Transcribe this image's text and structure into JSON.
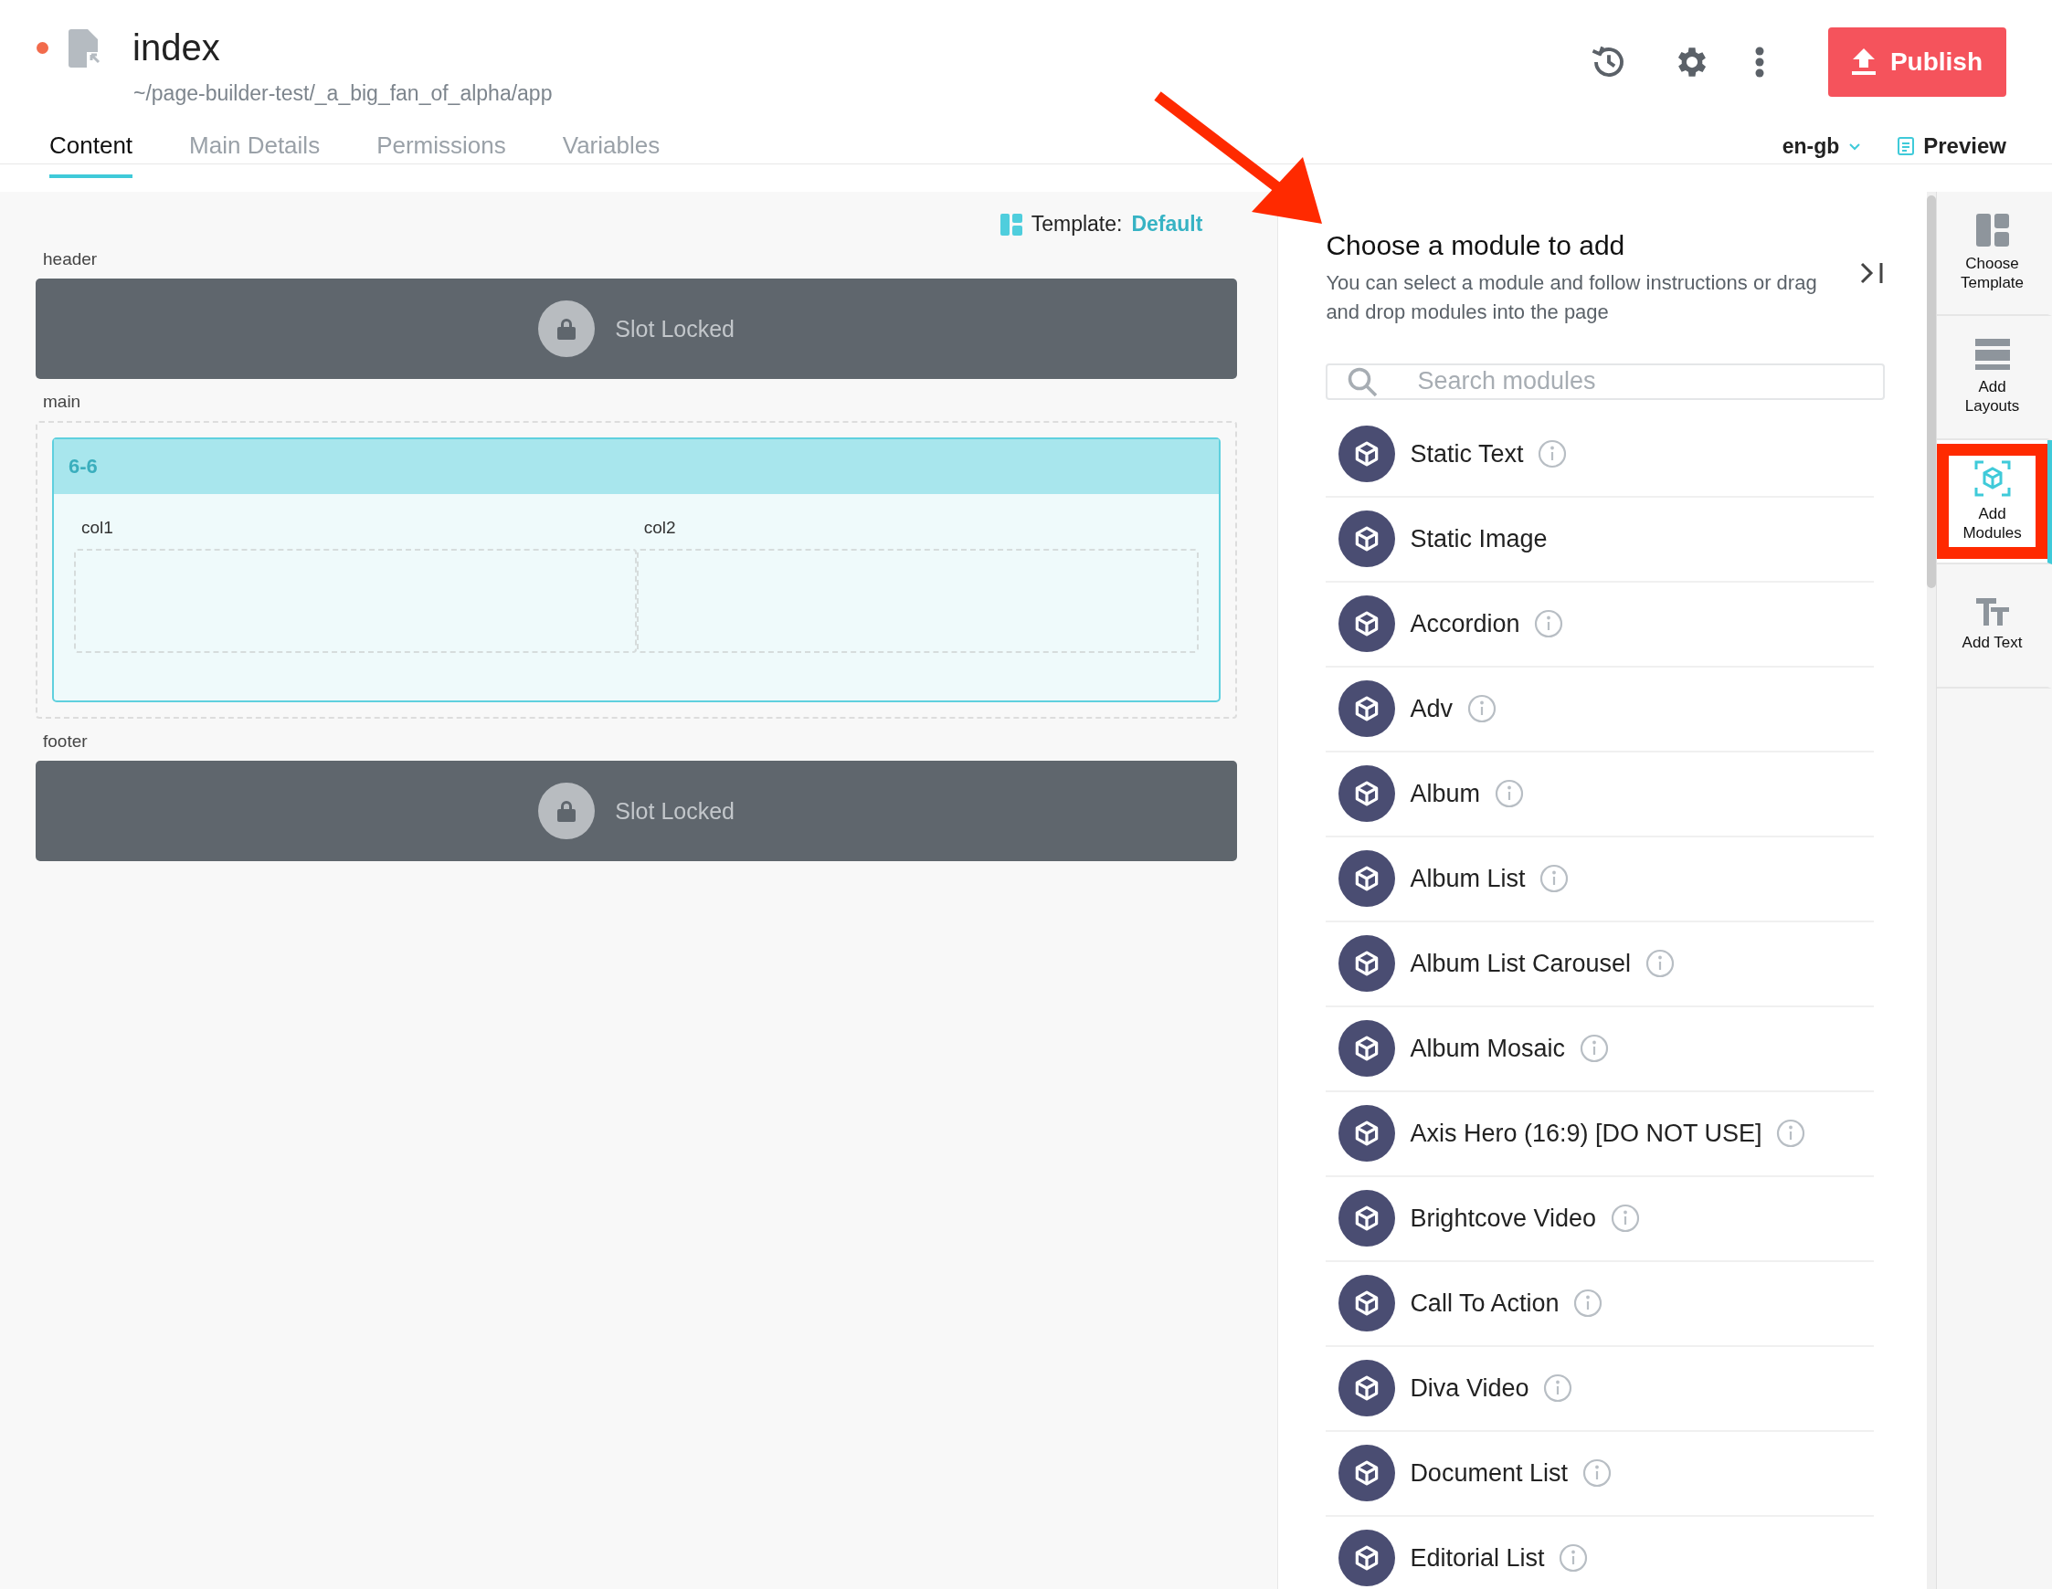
{
  "document": {
    "unsaved": true,
    "title": "index",
    "path": "~/page-builder-test/_a_big_fan_of_alpha/app"
  },
  "publish_button": "Publish",
  "tabs": [
    {
      "label": "Content",
      "selected": true
    },
    {
      "label": "Main Details",
      "selected": false
    },
    {
      "label": "Permissions",
      "selected": false
    },
    {
      "label": "Variables",
      "selected": false
    }
  ],
  "locale": "en-gb",
  "preview": "Preview",
  "template": {
    "label": "Template:",
    "value": "Default"
  },
  "slots": [
    {
      "name": "header",
      "kind": "locked",
      "text": "Slot Locked"
    },
    {
      "name": "main",
      "kind": "layout",
      "layout": {
        "title": "6-6",
        "columns": [
          "col1",
          "col2"
        ]
      }
    },
    {
      "name": "footer",
      "kind": "locked",
      "text": "Slot Locked"
    }
  ],
  "module_panel": {
    "title": "Choose a module to add",
    "description": "You can select a module and follow instructions or drag and drop modules into the page",
    "search_placeholder": "Search modules",
    "modules": [
      {
        "name": "Static Text",
        "info": true
      },
      {
        "name": "Static Image",
        "info": false
      },
      {
        "name": "Accordion",
        "info": true
      },
      {
        "name": "Adv",
        "info": true
      },
      {
        "name": "Album",
        "info": true
      },
      {
        "name": "Album List",
        "info": true
      },
      {
        "name": "Album List Carousel",
        "info": true
      },
      {
        "name": "Album Mosaic",
        "info": true
      },
      {
        "name": "Axis Hero (16:9) [DO NOT USE]",
        "info": true
      },
      {
        "name": "Brightcove Video",
        "info": true
      },
      {
        "name": "Call To Action",
        "info": true
      },
      {
        "name": "Diva Video",
        "info": true
      },
      {
        "name": "Document List",
        "info": true
      },
      {
        "name": "Editorial List",
        "info": true
      }
    ]
  },
  "tools": [
    {
      "kind": "template",
      "label": "Choose Template",
      "selected": false
    },
    {
      "kind": "layouts",
      "label": "Add Layouts",
      "selected": false
    },
    {
      "kind": "modules",
      "label": "Add Modules",
      "selected": true,
      "highlighted": true
    },
    {
      "kind": "text",
      "label": "Add Text",
      "selected": false
    }
  ]
}
